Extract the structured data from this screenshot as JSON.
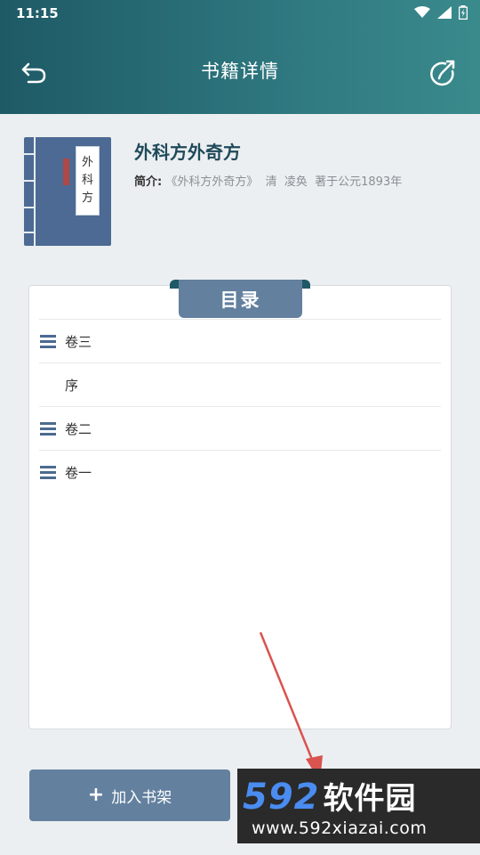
{
  "status_bar": {
    "time": "11:15"
  },
  "appbar": {
    "title": "书籍详情",
    "back_icon": "back-arrow-icon",
    "share_icon": "share-icon"
  },
  "book": {
    "title": "外科方外奇方",
    "cover_text": [
      "外",
      "科",
      "方"
    ],
    "intro_label": "简介:",
    "intro_text": "《外科方外奇方》  清  凌奂  著于公元1893年"
  },
  "toc": {
    "title": "目录",
    "items": [
      {
        "label": "卷三",
        "has_children": true
      },
      {
        "label": "序",
        "has_children": false
      },
      {
        "label": "卷二",
        "has_children": true
      },
      {
        "label": "卷一",
        "has_children": true
      }
    ]
  },
  "shelf_button": {
    "label": "加入书架"
  },
  "watermark": {
    "logo": "592",
    "logo_cn": "软件园",
    "url": "www.592xiazai.com"
  },
  "colors": {
    "header_start": "#1e5a66",
    "header_end": "#3a8a8c",
    "accent": "#63809f",
    "title": "#1f4a5a",
    "annotation": "#d9534f"
  }
}
